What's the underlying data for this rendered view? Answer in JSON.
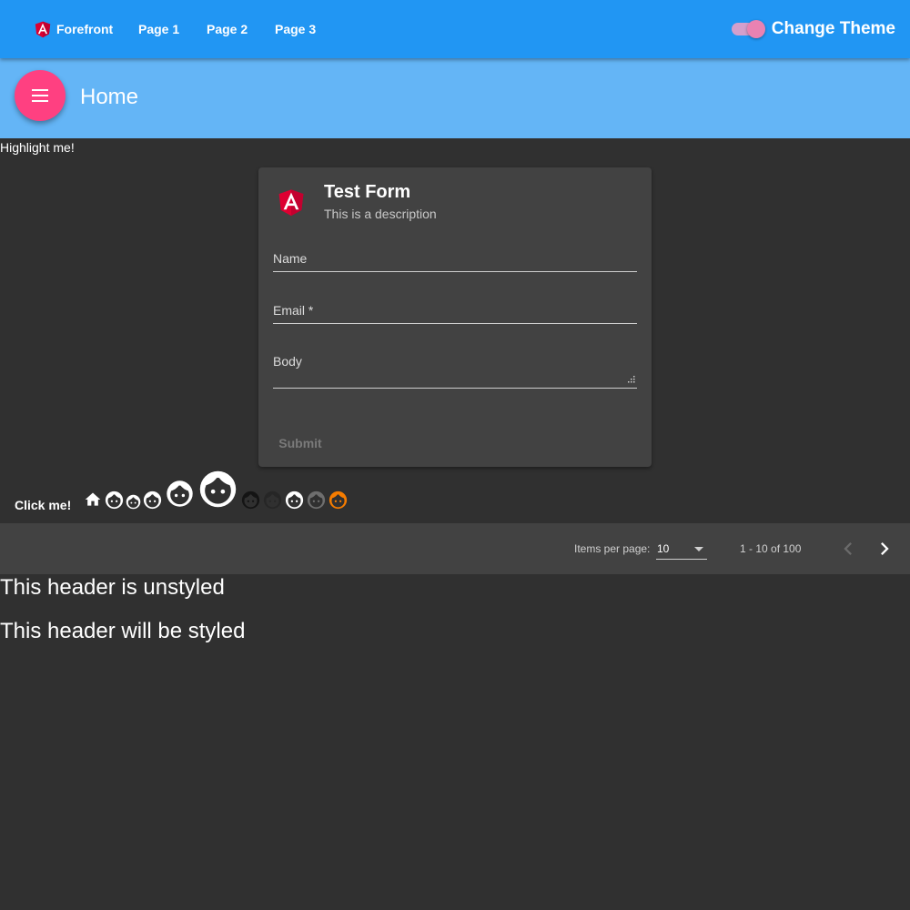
{
  "toolbar": {
    "brand": "Forefront",
    "links": [
      "Page 1",
      "Page 2",
      "Page 3"
    ],
    "theme_toggle_label": "Change Theme",
    "theme_toggle_on": true
  },
  "header": {
    "menu_icon": "menu-icon",
    "title": "Home"
  },
  "highlight_text": "Highlight me!",
  "form": {
    "logo_icon": "angular-logo-icon",
    "title": "Test Form",
    "subtitle": "This is a description",
    "fields": {
      "name": {
        "label": "Name",
        "value": ""
      },
      "email": {
        "label": "Email *",
        "value": ""
      },
      "body": {
        "label": "Body",
        "value": ""
      }
    },
    "submit_label": "Submit",
    "submit_disabled": true
  },
  "icon_row": {
    "label": "Click me!",
    "icons": [
      "home-icon",
      "face-icon",
      "face-icon",
      "face-icon",
      "face-icon",
      "face-icon",
      "face-icon",
      "face-icon",
      "face-icon",
      "face-icon",
      "face-icon"
    ]
  },
  "paginator": {
    "items_per_page_label": "Items per page:",
    "page_size": "10",
    "range_label": "1 - 10 of 100",
    "prev_icon": "chevron-left-icon",
    "next_icon": "chevron-right-icon",
    "prev_disabled": true
  },
  "headings": {
    "unstyled": "This header is unstyled",
    "styled": "This header will be styled"
  },
  "colors": {
    "primary": "#2196f3",
    "primary_light": "#64b5f6",
    "accent": "#ff4081",
    "background": "#303030",
    "card": "#424242",
    "angular_red": "#dd0031",
    "orange": "#f57c00"
  }
}
